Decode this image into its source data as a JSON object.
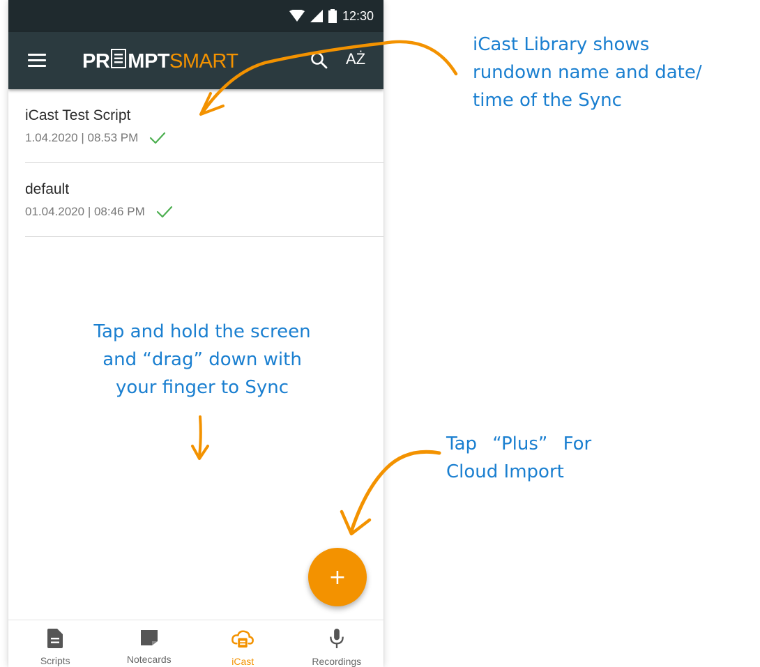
{
  "status_bar": {
    "time": "12:30"
  },
  "app_bar": {
    "logo_part1": "PR",
    "logo_part2": "MPT",
    "logo_part3": "SMART",
    "sort_label": "AŻ"
  },
  "rundowns": [
    {
      "title": "iCast Test Script",
      "date": "1.04.2020",
      "time": "08.53 PM",
      "separator": " | "
    },
    {
      "title": "default",
      "date": "01.04.2020",
      "time": "08:46 PM",
      "separator": " | "
    }
  ],
  "fab": {
    "label": "+"
  },
  "bottom_nav": [
    {
      "label": "Scripts",
      "icon": "document-icon",
      "active": false
    },
    {
      "label": "Notecards",
      "icon": "notecard-icon",
      "active": false
    },
    {
      "label": "iCast",
      "icon": "icast-cloud-icon",
      "active": true
    },
    {
      "label": "Recordings",
      "icon": "microphone-icon",
      "active": false
    }
  ],
  "annotations": {
    "library": [
      "iCast Library shows",
      "rundown name and date/",
      "time of the Sync"
    ],
    "sync": [
      "Tap and hold the screen",
      "and “drag” down with",
      "your finger to Sync"
    ],
    "plus": {
      "w1": "Tap",
      "w2": "“Plus”",
      "w3": "For",
      "line2": "Cloud Import"
    }
  },
  "colors": {
    "accent": "#f39200",
    "app_bar": "#2b3a3f",
    "status_bar": "#1f2a2e",
    "annotation_text": "#1a7fd0",
    "check": "#4caf50"
  }
}
